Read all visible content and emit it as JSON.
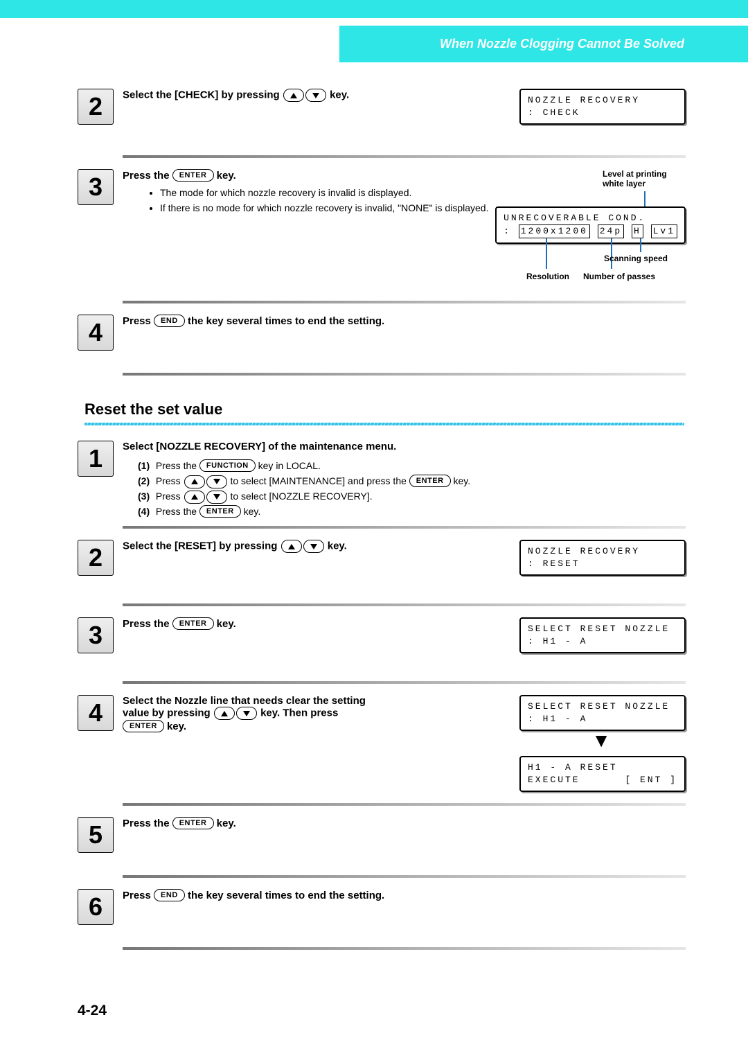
{
  "header": {
    "title": "When Nozzle Clogging Cannot Be Solved"
  },
  "section1": {
    "step2": {
      "num": "2",
      "before": "Select the [CHECK] by pressing ",
      "after": " key.",
      "lcd": {
        "line1": "NOZZLE RECOVERY",
        "line2": ": CHECK"
      }
    },
    "step3": {
      "num": "3",
      "before": "Press the ",
      "key": "ENTER",
      "after": " key.",
      "bullet1": "The mode for which nozzle recovery is invalid is displayed.",
      "bullet2": "If there is no mode for which nozzle recovery is invalid, \"NONE\" is displayed.",
      "lcd": {
        "line1": "UNRECOVERABLE COND.",
        "b1": "1200x1200",
        "b2": "24p",
        "b3": "H",
        "b4": "Lv1"
      },
      "callouts": {
        "level": "Level at printing white layer",
        "scan": "Scanning speed",
        "res": "Resolution",
        "passes": "Number of passes"
      }
    },
    "step4": {
      "num": "4",
      "before": "Press ",
      "key": "END",
      "after": " the key several times to end the setting."
    }
  },
  "section2": {
    "heading": "Reset the set value",
    "step1": {
      "num": "1",
      "title": "Select [NOZZLE RECOVERY] of the maintenance menu.",
      "s1a": "Press the ",
      "s1key": "FUNCTION",
      "s1b": " key in LOCAL.",
      "s2a": "Press ",
      "s2b": " to select [MAINTENANCE] and press the ",
      "s2key": "ENTER",
      "s2c": " key.",
      "s3a": "Press ",
      "s3b": " to select [NOZZLE RECOVERY].",
      "s4a": "Press the ",
      "s4key": "ENTER",
      "s4b": " key.",
      "idx1": "(1)",
      "idx2": "(2)",
      "idx3": "(3)",
      "idx4": "(4)"
    },
    "step2": {
      "num": "2",
      "before": "Select the [RESET] by pressing ",
      "after": " key.",
      "lcd": {
        "line1": "NOZZLE RECOVERY",
        "line2": ": RESET"
      }
    },
    "step3": {
      "num": "3",
      "before": "Press the ",
      "key": "ENTER",
      "after": " key.",
      "lcd": {
        "line1": "SELECT RESET NOZZLE",
        "line2": ": H1 - A"
      }
    },
    "step4": {
      "num": "4",
      "line1a": "Select the Nozzle line that needs clear the setting",
      "line2a": "value by pressing ",
      "line2b": " key. Then press ",
      "key": "ENTER",
      "line2c": " key.",
      "lcd1": {
        "line1": "SELECT RESET NOZZLE",
        "line2": ": H1 - A"
      },
      "lcd2": {
        "line1": "H1 - A  RESET",
        "line2a": "EXECUTE",
        "line2b": "[ ENT ]"
      }
    },
    "step5": {
      "num": "5",
      "before": "Press the ",
      "key": "ENTER",
      "after": " key."
    },
    "step6": {
      "num": "6",
      "before": "Press ",
      "key": "END",
      "after": " the key several times to end the setting."
    }
  },
  "page_number": "4-24"
}
